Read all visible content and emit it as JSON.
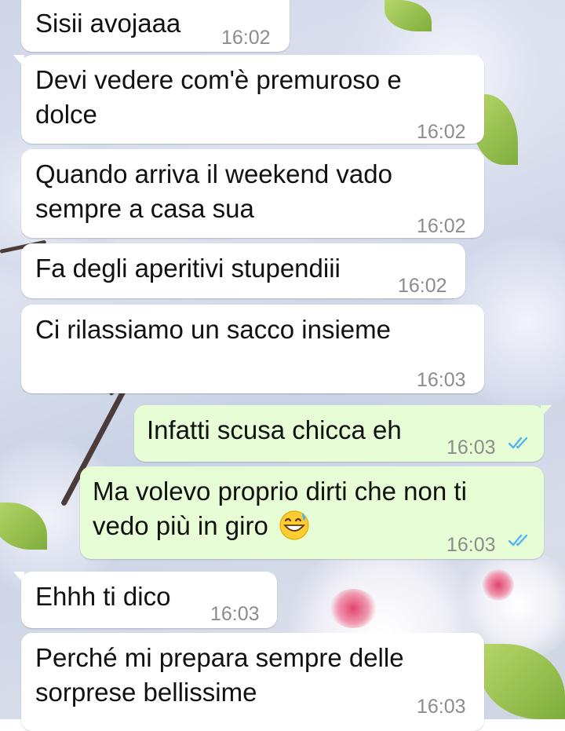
{
  "chat": {
    "messages": [
      {
        "direction": "in",
        "text": "Sisii avojaaa",
        "time": "16:02"
      },
      {
        "direction": "in",
        "line1": "Devi vedere com'è premuroso e",
        "line2": "dolce",
        "time": "16:02"
      },
      {
        "direction": "in",
        "line1": "Quando arriva il weekend vado",
        "line2": "sempre a casa sua",
        "time": "16:02"
      },
      {
        "direction": "in",
        "text": "Fa degli aperitivi stupendiii",
        "time": "16:02"
      },
      {
        "direction": "in",
        "text": "Ci rilassiamo un sacco insieme",
        "time": "16:03"
      },
      {
        "direction": "out",
        "text": "Infatti scusa chicca eh",
        "time": "16:03",
        "status": "read"
      },
      {
        "direction": "out",
        "line1": "Ma volevo proprio dirti che non ti",
        "line2": "vedo più in giro",
        "emoji": "grinning-face-with-sweat",
        "time": "16:03",
        "status": "read"
      },
      {
        "direction": "in",
        "text": "Ehhh ti dico",
        "time": "16:03"
      },
      {
        "direction": "in",
        "line1": "Perché mi prepara sempre delle",
        "line2": "sorprese bellissime",
        "time": "16:03"
      }
    ]
  },
  "colors": {
    "incoming_bubble": "#ffffff",
    "outgoing_bubble": "#e7fdd5",
    "timestamp": "#8c8c8c",
    "read_ticks": "#4fb6ec"
  },
  "icons": {
    "read_status": "double-check-icon"
  }
}
